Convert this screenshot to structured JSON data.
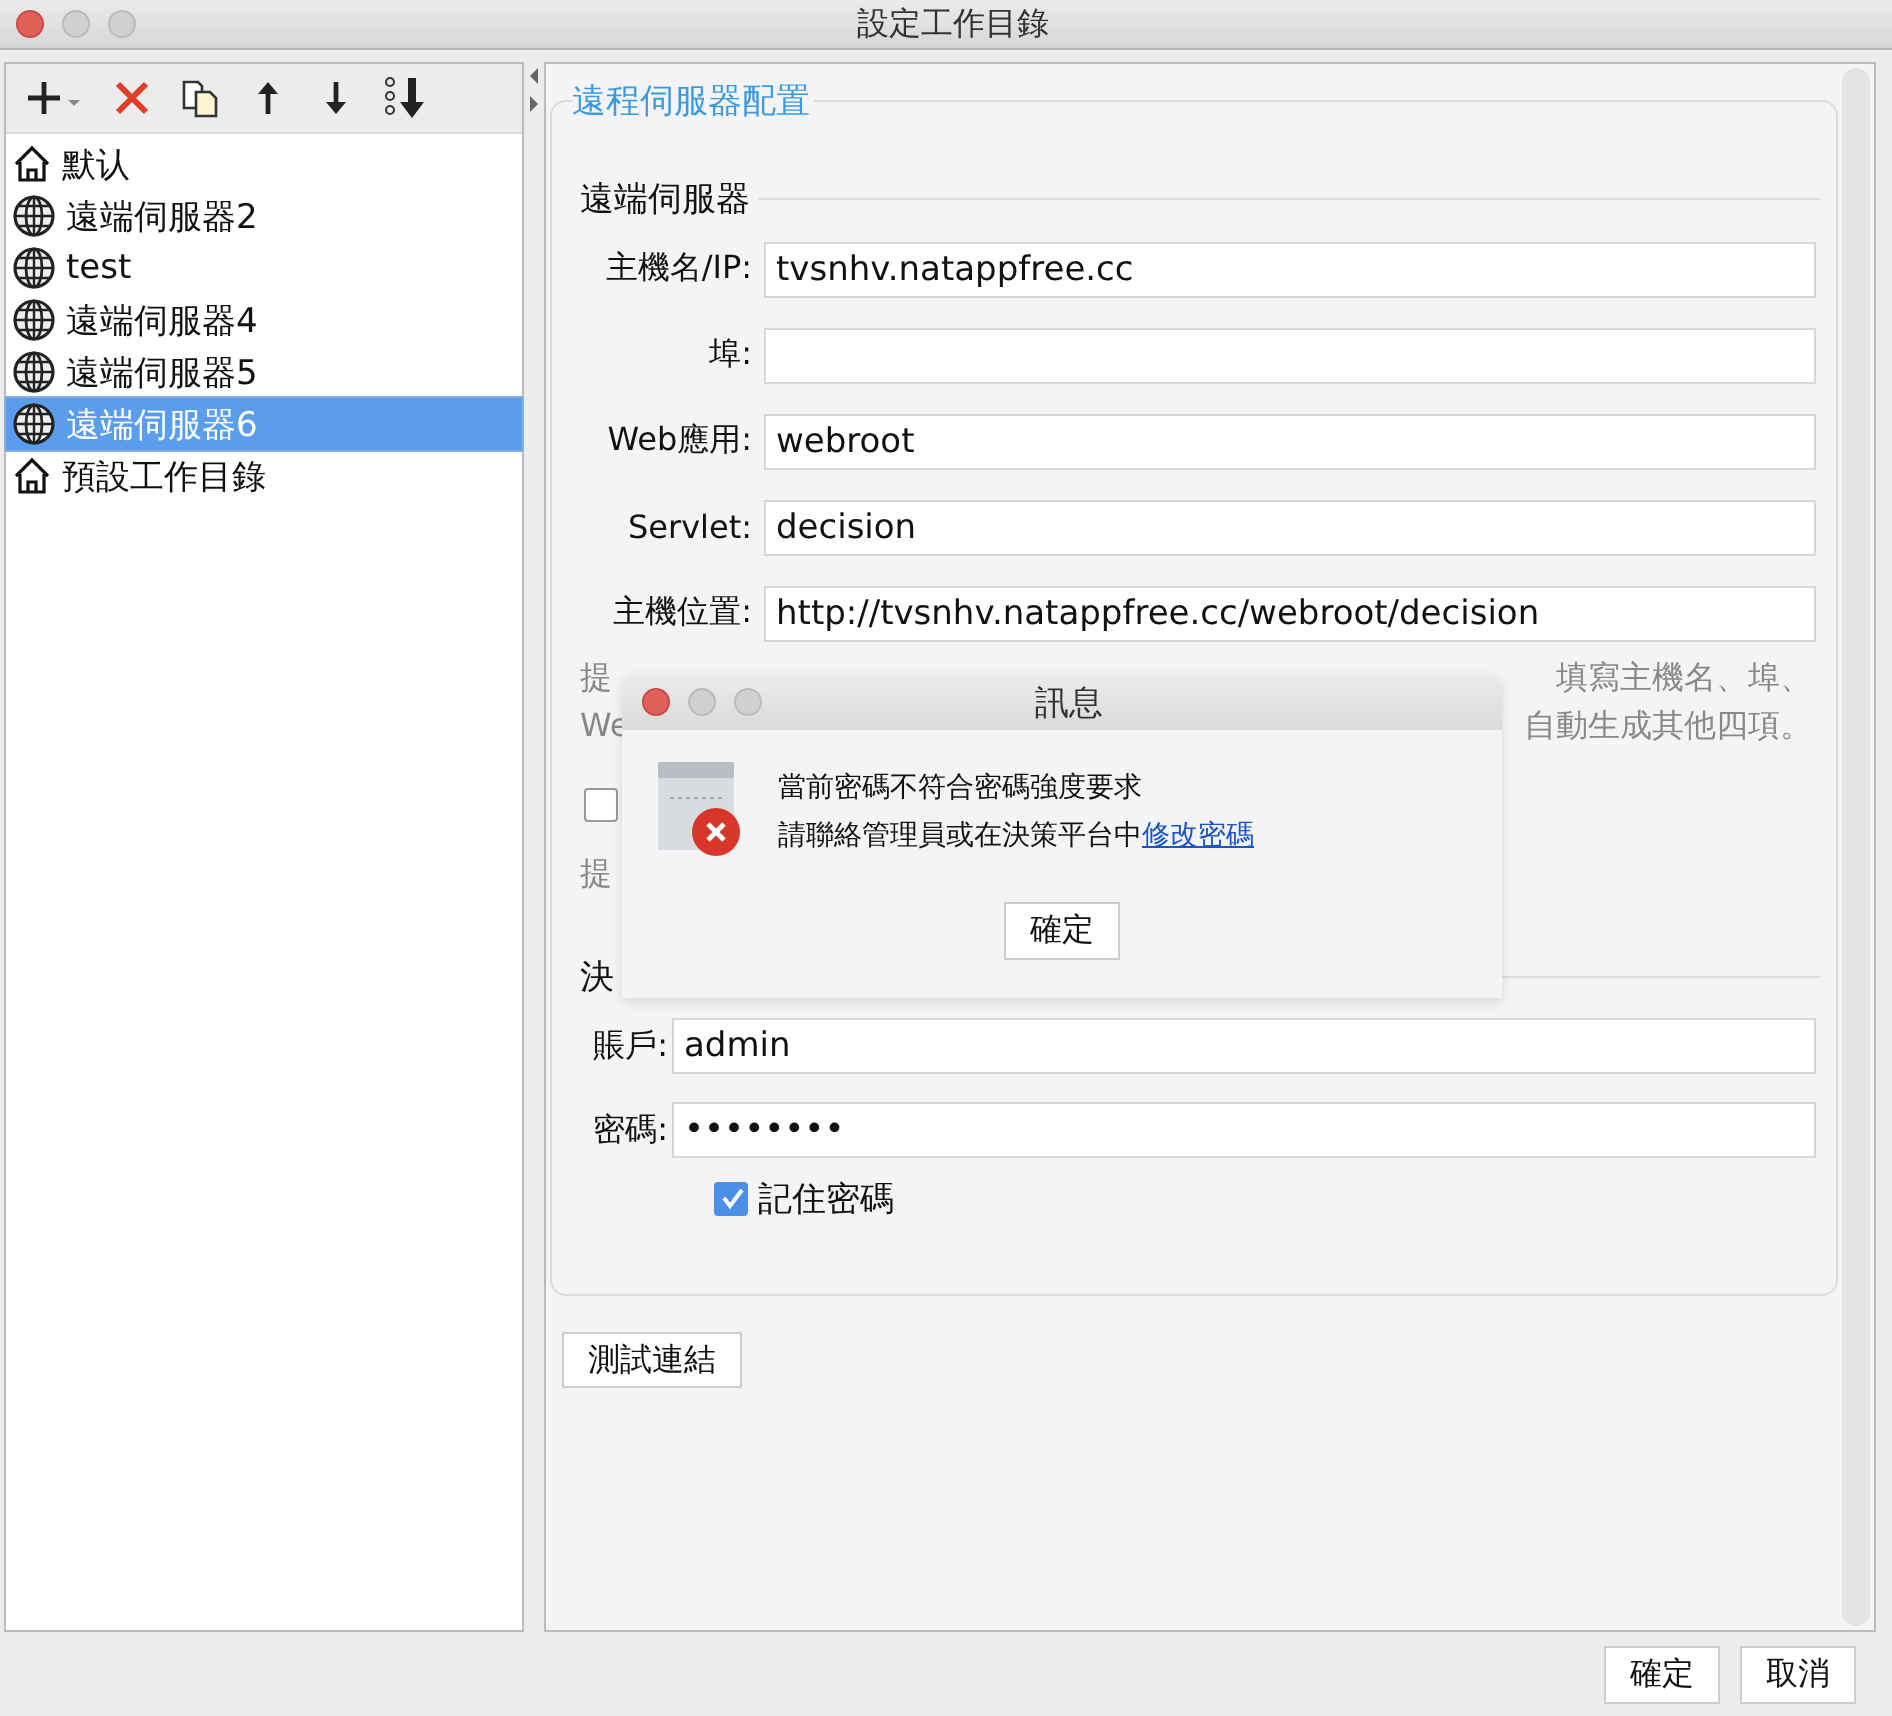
{
  "window": {
    "title": "設定工作目錄"
  },
  "sidebar": {
    "items": [
      {
        "label": "默认",
        "kind": "home",
        "selected": false
      },
      {
        "label": "遠端伺服器2",
        "kind": "globe",
        "selected": false
      },
      {
        "label": "test",
        "kind": "globe",
        "selected": false
      },
      {
        "label": "遠端伺服器4",
        "kind": "globe",
        "selected": false
      },
      {
        "label": "遠端伺服器5",
        "kind": "globe",
        "selected": false
      },
      {
        "label": "遠端伺服器6",
        "kind": "globe",
        "selected": true
      },
      {
        "label": "預設工作目錄",
        "kind": "home",
        "selected": false
      }
    ]
  },
  "config": {
    "title": "遠程伺服器配置",
    "server_section": {
      "title": "遠端伺服器",
      "fields": [
        {
          "label": "主機名/IP:",
          "value": "tvsnhv.natappfree.cc"
        },
        {
          "label": "埠:"
        },
        {
          "label": "Web應用:",
          "value": "webroot"
        },
        {
          "label": "Servlet:",
          "value": "decision"
        },
        {
          "label": "主機位置:",
          "value": "http://tvsnhv.natappfree.cc/webroot/decision"
        }
      ]
    },
    "hint_lines": [
      {
        "left": "提",
        "right": "填寫主機名、埠、"
      },
      {
        "left": "We",
        "right": "自動生成其他四項。"
      }
    ],
    "option_checkbox": {
      "checked": false
    },
    "hint2": "提",
    "platform_section": {
      "title": "決",
      "fields": [
        {
          "label": "賬戶:",
          "value": "admin"
        },
        {
          "label": "密碼:",
          "value": "••••••••"
        }
      ],
      "remember": {
        "label": "記住密碼",
        "checked": true
      }
    },
    "test_button": "測試連結"
  },
  "dialog": {
    "title": "訊息",
    "lines": [
      {
        "text": "當前密碼不符合密碼強度要求"
      },
      {
        "text": "請聯絡管理員或在決策平台中",
        "link": "修改密碼"
      }
    ],
    "button": "確定"
  },
  "buttons": [
    "確定",
    "取消"
  ]
}
